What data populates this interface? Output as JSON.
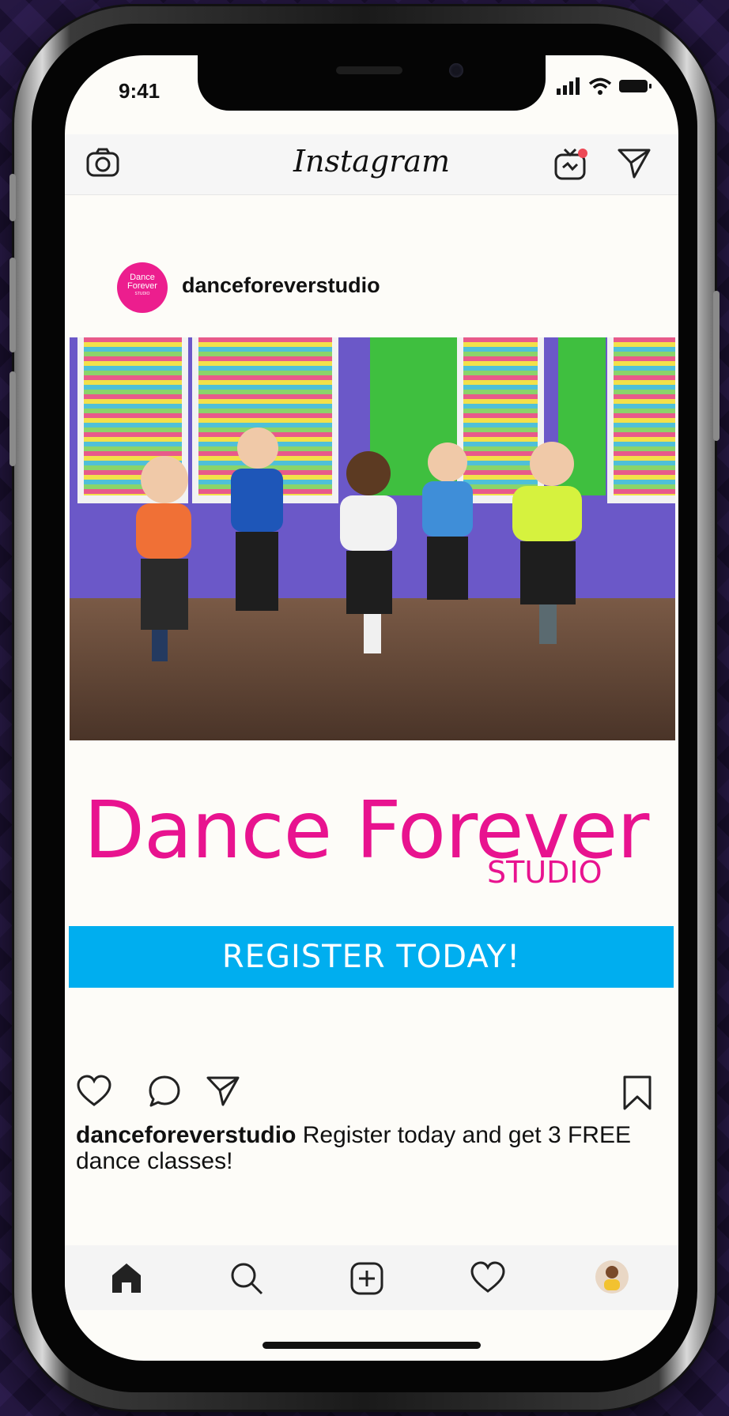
{
  "status_bar": {
    "time": "9:41"
  },
  "header": {
    "app_name": "Instagram"
  },
  "post": {
    "avatar_text": {
      "line1": "Dance",
      "line2": "Forever",
      "line3": "STUDIO"
    },
    "username": "danceforeverstudio",
    "headline": "Dance Forever",
    "subheadline": "STUDIO",
    "cta_label": "REGISTER TODAY!",
    "caption_user": "danceforeverstudio",
    "caption_text": " Register today and get 3 FREE dance classes!"
  },
  "icons": {
    "camera": "camera-icon",
    "igtv": "igtv-icon",
    "direct": "direct-message-icon",
    "like": "heart-icon",
    "comment": "comment-icon",
    "share": "share-icon",
    "save": "bookmark-icon",
    "home": "home-icon",
    "search": "search-icon",
    "add": "add-post-icon",
    "activity": "activity-heart-icon"
  },
  "colors": {
    "brand_pink": "#e8138f",
    "cta_blue": "#00aeef",
    "avatar_pink": "#ec1e8e"
  }
}
